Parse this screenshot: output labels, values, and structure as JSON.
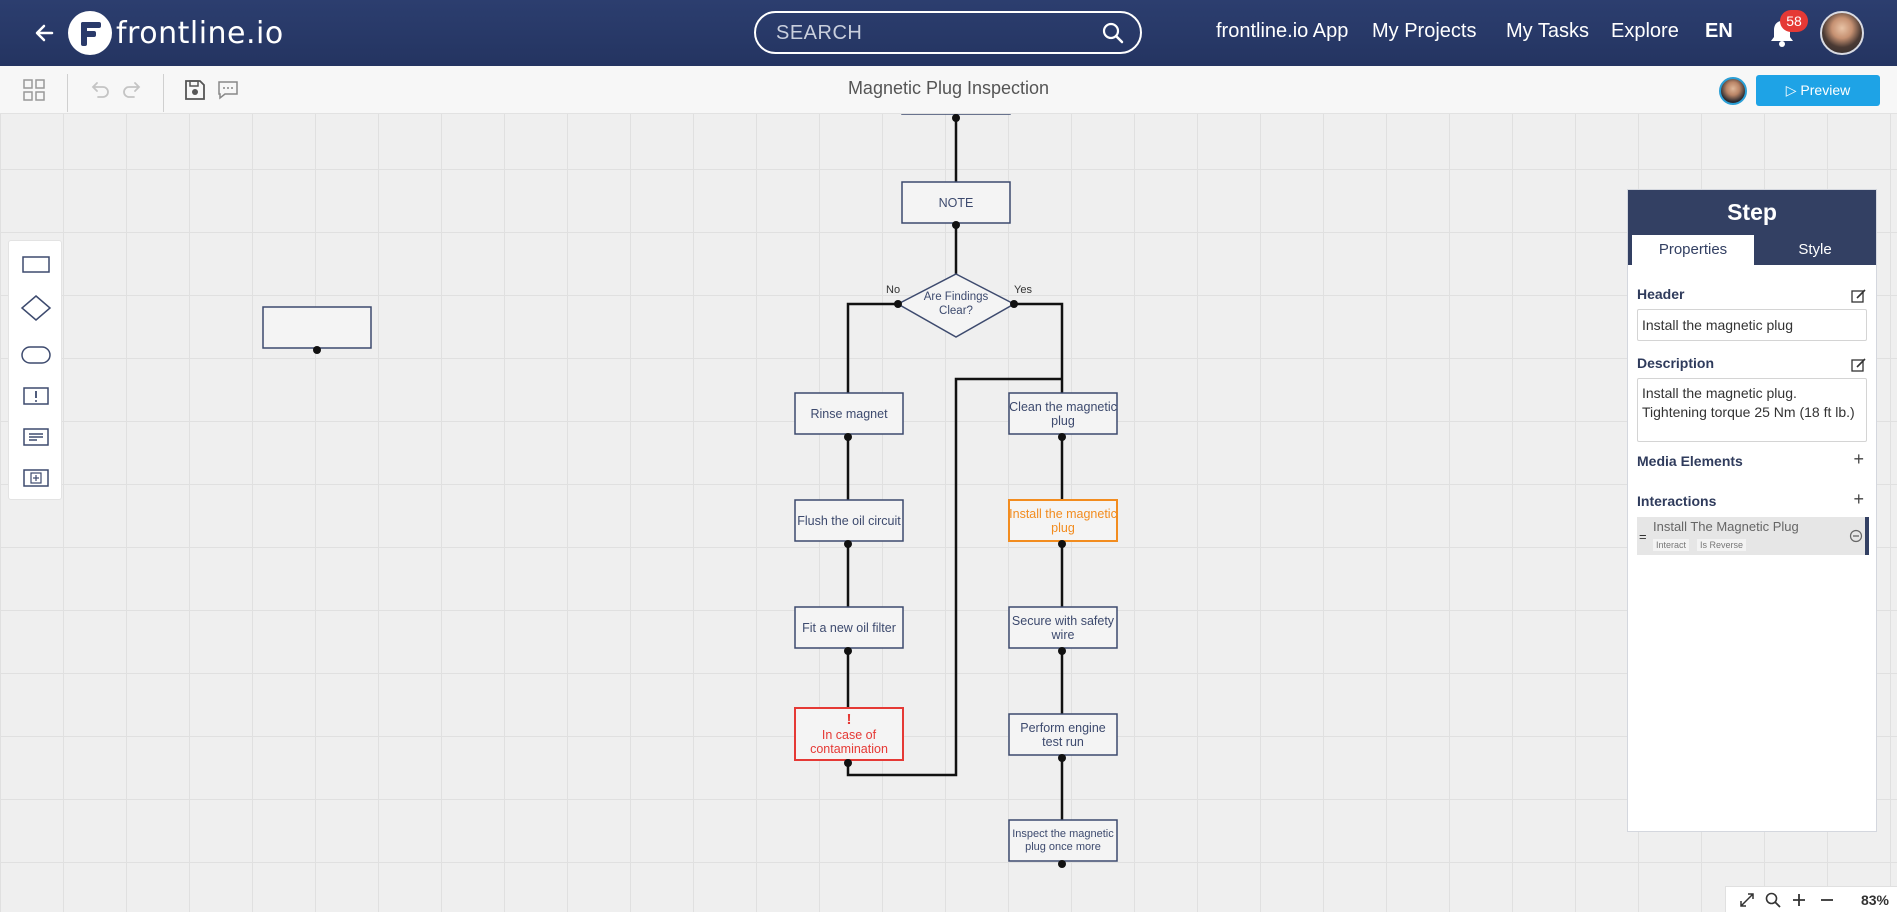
{
  "nav": {
    "brand": "frontline.io",
    "search_placeholder": "SEARCH",
    "links": [
      "frontline.io App",
      "My Projects",
      "My Tasks",
      "Explore"
    ],
    "language": "EN",
    "notification_count": "58"
  },
  "toolbar": {
    "document_title": "Magnetic Plug Inspection",
    "preview_label": "Preview"
  },
  "flowchart": {
    "nodes": {
      "note": "NOTE",
      "decision": "Are Findings Clear?",
      "rinse": "Rinse magnet",
      "flush": "Flush the oil circuit",
      "fit": "Fit a new oil filter",
      "contamination_mark": "!",
      "contamination": "In case of contamination",
      "clean": "Clean the magnetic plug",
      "install": "Install the magnetic plug",
      "secure": "Secure with safety wire",
      "engine": "Perform engine test run",
      "inspect": "Inspect the magnetic plug once more"
    },
    "branch_no": "No",
    "branch_yes": "Yes"
  },
  "panel": {
    "title": "Step",
    "tabs": [
      "Properties",
      "Style"
    ],
    "header_label": "Header",
    "header_value": "Install the magnetic plug",
    "description_label": "Description",
    "description_value": "Install the magnetic plug. Tightening torque 25 Nm (18 ft lb.)",
    "media_label": "Media Elements",
    "interactions_label": "Interactions",
    "interaction": {
      "title": "Install The Magnetic Plug",
      "tag1": "Interact",
      "tag2": "Is Reverse"
    }
  },
  "zoom": {
    "level": "83%"
  },
  "colors": {
    "nav_bg": "#2c3e6f",
    "node_border": "#3d4a6e",
    "warning": "#e53935",
    "active": "#f28c1f",
    "accent": "#1ea3e6"
  }
}
